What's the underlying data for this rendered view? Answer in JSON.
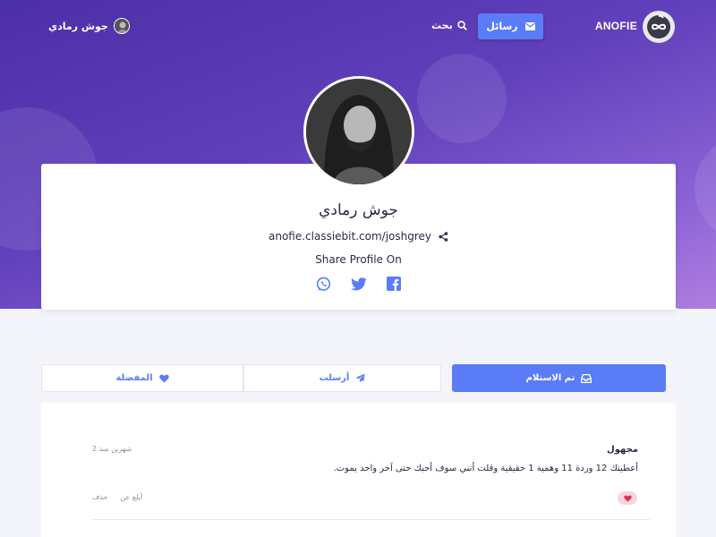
{
  "brand": {
    "name": "ANOFIE",
    "logo_icon": "infinity-logo-icon"
  },
  "topbar": {
    "messages_label": "رسائل",
    "messages_icon": "envelope-icon",
    "search_label": "بحث",
    "search_icon": "search-icon",
    "user_name": "جوش رمادي"
  },
  "profile": {
    "name": "جوش رمادي",
    "url": "anofie.classiebit.com/joshgrey",
    "share_title": "Share Profile On",
    "socials": [
      "whatsapp-icon",
      "twitter-icon",
      "facebook-icon"
    ]
  },
  "tabs": {
    "favorites": "المفضلة",
    "sent": "أرسلت",
    "received": "تم الاستلام"
  },
  "message": {
    "from": "مجهول",
    "time": "2 شهرين منذ",
    "text": "أعطيتك 12 وردة 11 وهمية 1 حقيقية وقلت أنني سوف أحبك حتى آخر واحد يموت.",
    "report_label": "أبلغ عن",
    "delete_label": "حذف"
  },
  "colors": {
    "accent": "#5b7cf7",
    "hero_start": "#4c2fa8",
    "hero_end": "#b07de0",
    "heart": "#e0314b"
  }
}
